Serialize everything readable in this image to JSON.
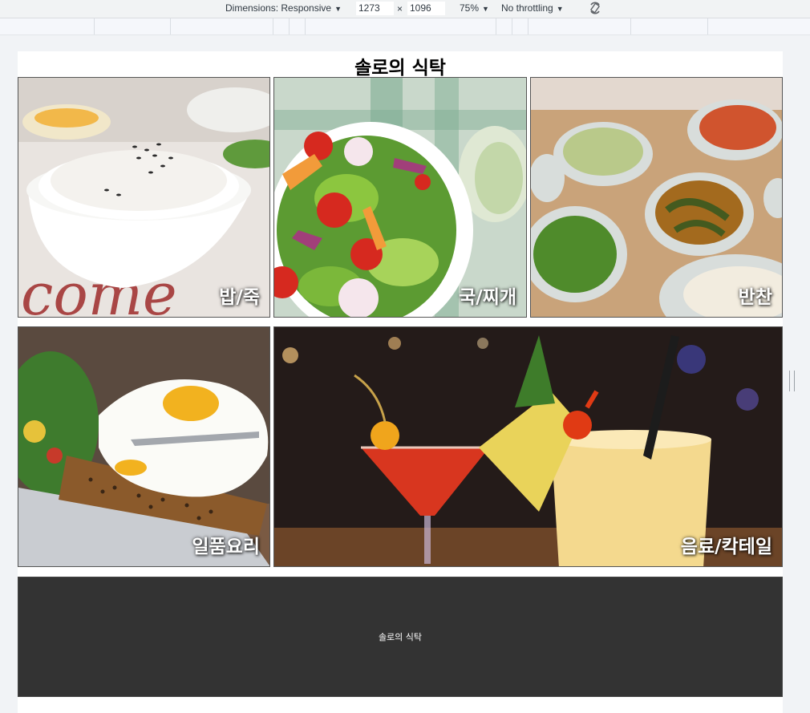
{
  "devtools": {
    "dimensions_label": "Dimensions: Responsive",
    "width_value": "1273",
    "times": "×",
    "height_value": "1096",
    "zoom_label": "75%",
    "throttle_label": "No throttling",
    "caret": "▼"
  },
  "site": {
    "title": "솔로의 식탁",
    "tiles": [
      {
        "label": "밥/죽",
        "icon": "rice-bowl-photo"
      },
      {
        "label": "국/찌개",
        "icon": "salad-photo"
      },
      {
        "label": "반찬",
        "icon": "side-dishes-photo"
      },
      {
        "label": "일품요리",
        "icon": "egg-toast-photo"
      },
      {
        "label": "음료/칵테일",
        "icon": "cocktail-photo"
      }
    ],
    "footer_text": "솔로의 식탁"
  },
  "colors": {
    "footer_bg": "#333333",
    "label_text": "#ffffff"
  }
}
